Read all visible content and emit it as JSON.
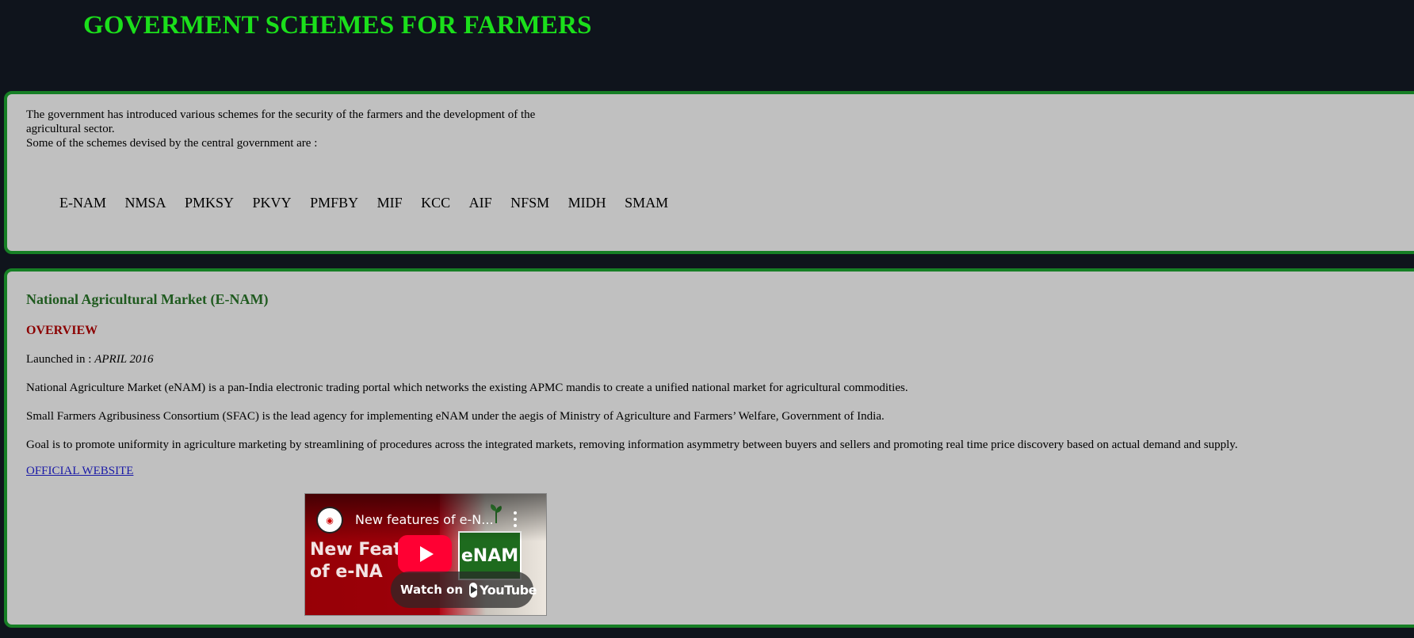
{
  "header": {
    "title": "GOVERMENT SCHEMES FOR FARMERS"
  },
  "intro": {
    "line1": "The government has introduced various schemes for the security of the farmers and the development of the agricultural sector.",
    "line2": "Some of the schemes devised by the central government are :"
  },
  "schemes_nav": [
    "E-NAM",
    "NMSA",
    "PMKSY",
    "PKVY",
    "PMFBY",
    "MIF",
    "KCC",
    "AIF",
    "NFSM",
    "MIDH",
    "SMAM"
  ],
  "enam": {
    "title": "National Agricultural Market (E-NAM)",
    "overview_heading": "OVERVIEW",
    "launched_label": "Launched in : ",
    "launched_value": "APRIL 2016",
    "description_1": "National Agriculture Market (eNAM) is a pan-India electronic trading portal which networks the existing APMC mandis to create a unified national market for agricultural commodities.",
    "description_2": "Small Farmers Agribusiness Consortium (SFAC) is the lead agency for implementing eNAM under the aegis of Ministry of Agriculture and Farmers’ Welfare, Government of India.",
    "description_3": "Goal is to promote uniformity in agriculture marketing by streamlining of procedures across the integrated markets, removing information asymmetry between buyers and sellers and promoting real time price discovery based on actual demand and supply.",
    "official_link": "OFFICIAL WEBSITE",
    "video": {
      "title": "New features of e-N...",
      "thumbnail_text_1": "New Feat",
      "thumbnail_text_2": "of e-NA",
      "logo_text": "eNAM",
      "channel_icon": "channel-avatar-icon",
      "watch_label": "Watch on",
      "platform": "YouTube"
    }
  },
  "colors": {
    "background": "#0f141c",
    "header": "#1bdf1b",
    "panel": "#c0c0c0",
    "panel_border": "#167f25",
    "scheme_title": "#1f5a1f",
    "overview_heading": "#8b0000",
    "link": "#1a1aa6"
  }
}
